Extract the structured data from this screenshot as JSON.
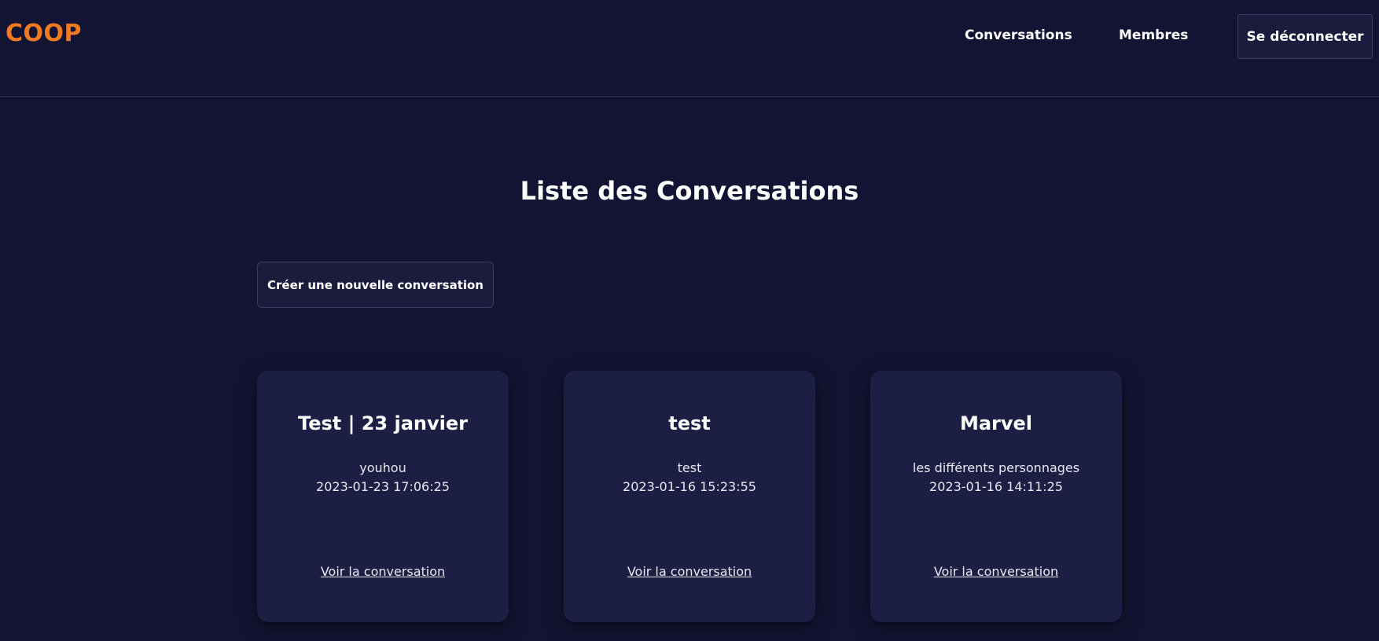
{
  "header": {
    "logo": "COOP",
    "nav": {
      "conversations": "Conversations",
      "membres": "Membres"
    },
    "logout_label": "Se déconnecter"
  },
  "main": {
    "title": "Liste des Conversations",
    "create_label": "Créer une nouvelle conversation",
    "conversations": [
      {
        "title": "Test | 23 janvier",
        "description": "youhou",
        "date": "2023-01-23 17:06:25",
        "link_label": "Voir la conversation"
      },
      {
        "title": "test",
        "description": "test",
        "date": "2023-01-16 15:23:55",
        "link_label": "Voir la conversation"
      },
      {
        "title": "Marvel",
        "description": "les différents personnages",
        "date": "2023-01-16 14:11:25",
        "link_label": "Voir la conversation"
      }
    ]
  },
  "colors": {
    "background": "#131433",
    "card": "#1d1e43",
    "accent": "#f07a22"
  }
}
